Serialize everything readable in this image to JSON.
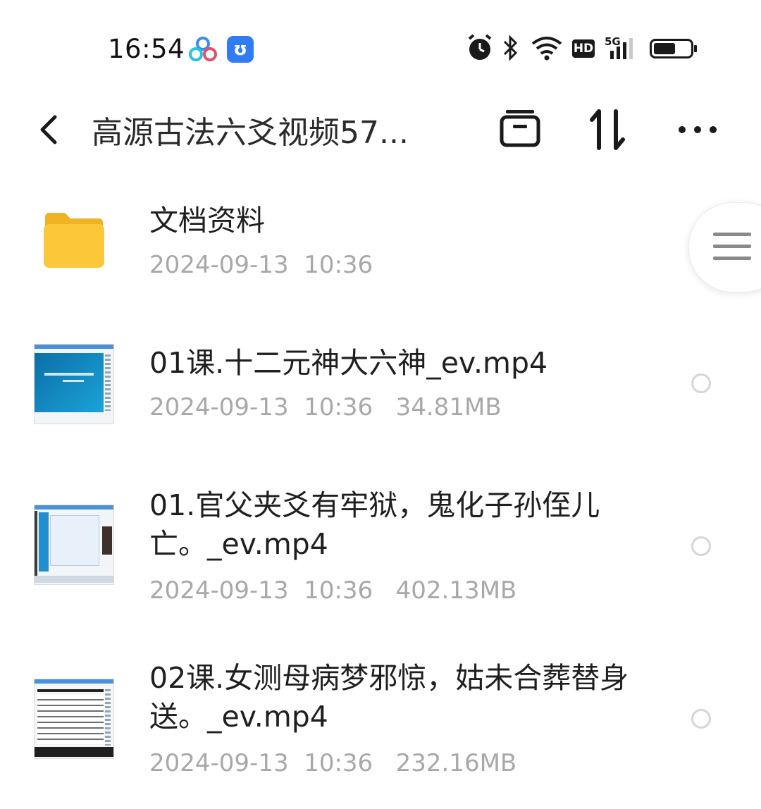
{
  "status_bar": {
    "time": "16:54",
    "icons": [
      "app-pinwheel-icon",
      "app-notification-icon",
      "alarm-icon",
      "bluetooth-icon",
      "wifi-icon",
      "hd-icon",
      "5g-signal-icon",
      "battery-icon"
    ],
    "hd_label": "HD",
    "network_label": "5G"
  },
  "header": {
    "title": "高源古法六爻视频57...",
    "icons": [
      "back-icon",
      "archive-icon",
      "sort-icon",
      "more-icon"
    ]
  },
  "files": [
    {
      "name": "文档资料",
      "meta": "2024-09-13  10:36",
      "type": "folder"
    },
    {
      "name": "01课.十二元神大六神_ev.mp4",
      "meta": "2024-09-13  10:36   34.81MB",
      "type": "video"
    },
    {
      "name": "01.官父夹爻有牢狱，鬼化子孙侄儿亡。_ev.mp4",
      "meta": "2024-09-13  10:36   402.13MB",
      "type": "video"
    },
    {
      "name": "02课.女测母病梦邪惊，姑未合葬替身送。_ev.mp4",
      "meta": "2024-09-13  10:36   232.16MB",
      "type": "video"
    }
  ],
  "colors": {
    "folder": "#fcc83a",
    "accent": "#2f7cf6",
    "meta": "#a8a8a8"
  }
}
